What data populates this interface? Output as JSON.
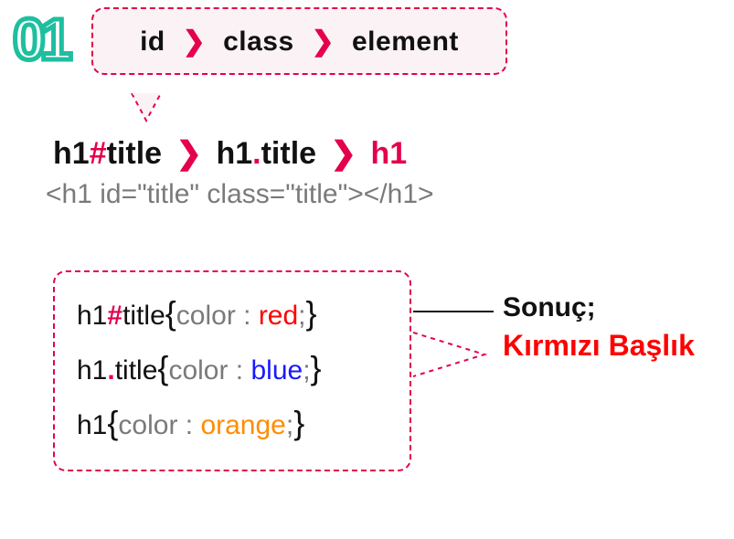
{
  "badge": "01",
  "bubble": {
    "a": "id",
    "b": "class",
    "c": "element"
  },
  "hier": {
    "p1a": "h1",
    "p1b": "#",
    "p1c": "title",
    "p2a": "h1",
    "p2b": ".",
    "p2c": "title",
    "p3": "h1"
  },
  "tag": "<h1 id=\"title\" class=\"title\"></h1>",
  "code": {
    "l1": {
      "sel_a": "h1",
      "sel_b": "#",
      "sel_c": "title",
      "prop": "color : ",
      "val": "red",
      "semi": ";"
    },
    "l2": {
      "sel_a": "h1",
      "sel_b": ".",
      "sel_c": "title",
      "prop": "color : ",
      "val": "blue",
      "semi": ";"
    },
    "l3": {
      "sel_a": "h1",
      "prop": "color : ",
      "val": "orange",
      "semi": ";"
    }
  },
  "result": {
    "label": "Sonuç;",
    "output": "Kırmızı Başlık"
  }
}
